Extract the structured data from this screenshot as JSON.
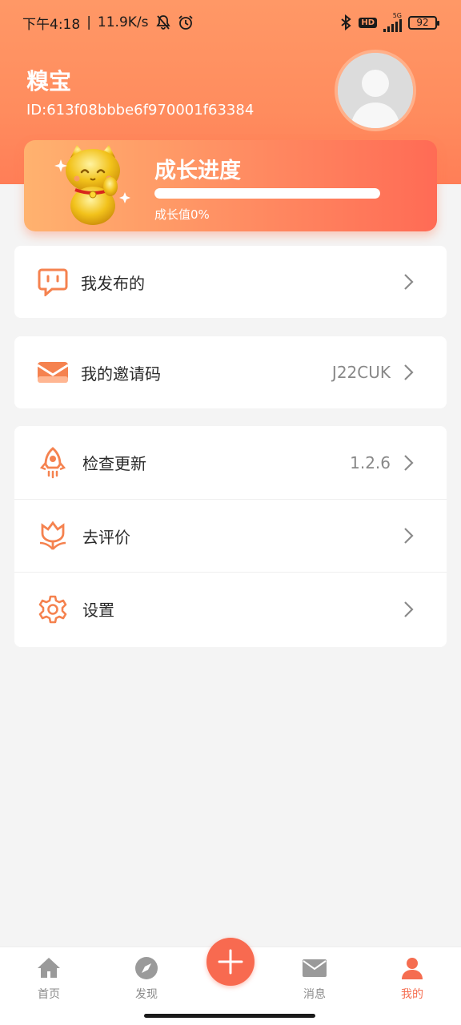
{
  "status_bar": {
    "time": "下午4:18",
    "network_speed": "11.9K/s",
    "network_type": "5G",
    "hd_badge": "HD",
    "battery": "92"
  },
  "profile": {
    "name": "糗宝",
    "id": "ID:613f08bbbe6f970001f63384"
  },
  "growth": {
    "title": "成长进度",
    "value_label": "成长值0%",
    "progress_percent": 0
  },
  "menu": {
    "published": {
      "label": "我发布的",
      "icon": "chat-bubble-icon"
    },
    "invite_code": {
      "label": "我的邀请码",
      "value": "J22CUK",
      "icon": "envelope-icon"
    },
    "check_update": {
      "label": "检查更新",
      "value": "1.2.6",
      "icon": "rocket-icon"
    },
    "rate": {
      "label": "去评价",
      "icon": "tulip-icon"
    },
    "settings": {
      "label": "设置",
      "icon": "gear-icon"
    }
  },
  "bottom_nav": {
    "home": "首页",
    "discover": "发现",
    "messages": "消息",
    "mine": "我的"
  },
  "colors": {
    "accent": "#f86a50",
    "header_gradient_start": "#ff9866",
    "icon_orange": "#f5824f"
  }
}
